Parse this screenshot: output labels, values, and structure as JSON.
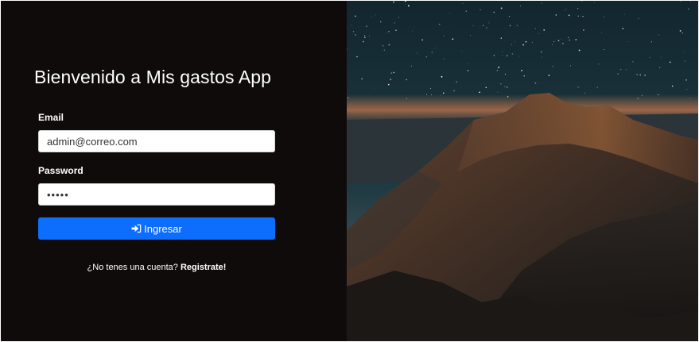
{
  "login": {
    "title": "Bienvenido a Mis gastos App",
    "email_label": "Email",
    "email_value": "admin@correo.com",
    "password_label": "Password",
    "password_value": "12345",
    "submit_label": "Ingresar",
    "submit_icon": "sign-in-icon",
    "register_prompt": "¿No tenes una cuenta?",
    "register_link": "Registrate!"
  },
  "colors": {
    "panel_background": "#0f0b0b",
    "primary_button": "#0d6efd",
    "text": "#ffffff"
  },
  "hero_image": {
    "subject": "starry-sky-over-mountain-range"
  }
}
